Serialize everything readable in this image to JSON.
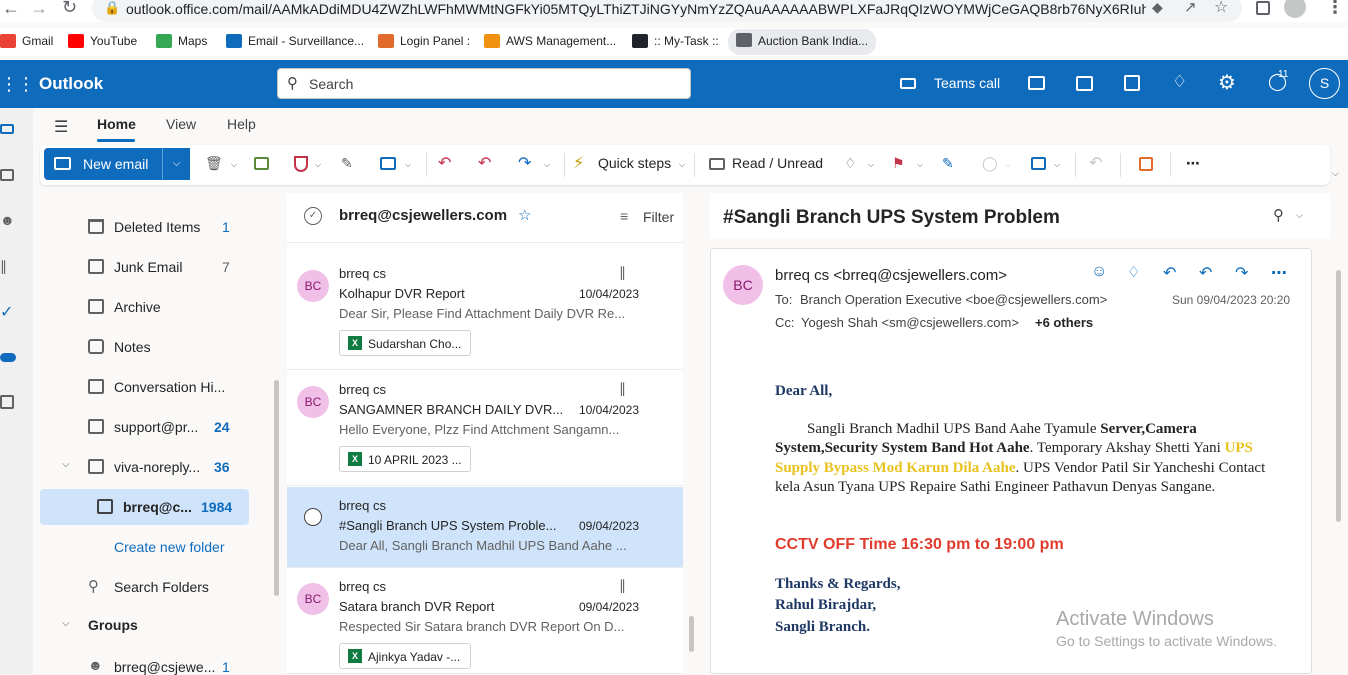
{
  "browser": {
    "url": "outlook.office.com/mail/AAMkADdiMDU4ZWZhLWFhMWMtNGFkYi05MTQyLThiZTJiNGYyNmYzZQAuAAAAAABWPLXFaJRqQIzWOYMWjCeGAQB8rb76NyX6RIuhpp...",
    "bookmarks": [
      {
        "label": "Gmail",
        "color": "#ea4335"
      },
      {
        "label": "YouTube",
        "color": "#ff0000"
      },
      {
        "label": "Maps",
        "color": "#34a853"
      },
      {
        "label": "Email - Surveillance...",
        "color": "#0f6cbd"
      },
      {
        "label": "Login Panel :",
        "color": "#e06b2b"
      },
      {
        "label": "AWS Management...",
        "color": "#f29111"
      },
      {
        "label": ":: My-Task ::",
        "color": "#20232a"
      },
      {
        "label": "Auction Bank India...",
        "color": "#5f6368"
      }
    ]
  },
  "header": {
    "app_name": "Outlook",
    "search_placeholder": "Search",
    "teams_call": "Teams call",
    "notif_count": "11",
    "avatar_initial": "S"
  },
  "menu_tabs": [
    "Home",
    "View",
    "Help"
  ],
  "ribbon": {
    "new_email": "New email",
    "quick_steps": "Quick steps",
    "read_unread": "Read / Unread"
  },
  "folders": [
    {
      "label": "Deleted Items",
      "count": "1",
      "icon": "trash-icon"
    },
    {
      "label": "Junk Email",
      "count": "7",
      "icon": "junk-icon"
    },
    {
      "label": "Archive",
      "count": "",
      "icon": "archive-icon"
    },
    {
      "label": "Notes",
      "count": "",
      "icon": "notes-icon"
    },
    {
      "label": "Conversation Hi...",
      "count": "",
      "icon": "folder-icon"
    },
    {
      "label": "support@pr...",
      "count": "24",
      "icon": "folder-icon"
    },
    {
      "label": "viva-noreply...",
      "count": "36",
      "icon": "folder-icon"
    },
    {
      "label": "brreq@c...",
      "count": "1984",
      "icon": "folder-icon"
    }
  ],
  "create_folder": "Create new folder",
  "search_folders": "Search Folders",
  "groups_label": "Groups",
  "group_item": {
    "label": "brreq@csjewe...",
    "count": "1"
  },
  "list_header": {
    "title": "brreq@csjewellers.com",
    "filter": "Filter"
  },
  "mails": [
    {
      "from": "brreq cs",
      "subject": "Kolhapur DVR Report",
      "date": "10/04/2023",
      "preview": "Dear Sir, Please Find Attachment Daily DVR Re...",
      "attachment": "Sudarshan Cho..."
    },
    {
      "from": "brreq cs",
      "subject": "SANGAMNER BRANCH DAILY DVR...",
      "date": "10/04/2023",
      "preview": "Hello Everyone, Plzz Find Attchment Sangamn...",
      "attachment": "10 APRIL 2023 ..."
    },
    {
      "from": "brreq cs",
      "subject": "#Sangli Branch UPS System Proble...",
      "date": "09/04/2023",
      "preview": "Dear All, Sangli Branch Madhil UPS Band Aahe ...",
      "attachment": ""
    },
    {
      "from": "brreq cs",
      "subject": "Satara branch DVR Report",
      "date": "09/04/2023",
      "preview": "Respected Sir Satara branch DVR Report On D...",
      "attachment": "Ajinkya Yadav -..."
    }
  ],
  "avatar_initials": "BC",
  "reading": {
    "subject": "#Sangli Branch UPS System Problem",
    "from": "brreq cs <brreq@csjewellers.com>",
    "to_label": "To:",
    "to": "Branch Operation Executive <boe@csjewellers.com>",
    "date": "Sun 09/04/2023 20:20",
    "cc_label": "Cc:",
    "cc": "Yogesh Shah <sm@csjewellers.com>",
    "cc_more": "+6 others",
    "greeting": "Dear All,",
    "body_1": "Sangli Branch Madhil UPS Band Aahe Tyamule ",
    "body_bold": "Server,Camera System,Security System Band Hot Aahe",
    "body_2": ". Temporary Akshay Shetti Yani ",
    "body_yellow": "UPS Supply Bypass  Mod Karun Dila Aahe",
    "body_3": ". UPS Vendor Patil Sir Yancheshi Contact kela Asun Tyana UPS Repaire Sathi Engineer Pathavun Denyas Sangane.",
    "cctv": "CCTV OFF Time 16:30 pm to 19:00 pm",
    "sign_1": "Thanks & Regards,",
    "sign_2": "Rahul Birajdar,",
    "sign_3": "Sangli Branch."
  },
  "watermark": {
    "title": "Activate Windows",
    "sub": "Go to Settings to activate Windows."
  },
  "colors": {
    "accent": "#0f6cbd",
    "selected_bg": "#cfe4fa",
    "red": "#e03b2d",
    "yellow": "#e8c21e",
    "navy": "#1f3864"
  }
}
